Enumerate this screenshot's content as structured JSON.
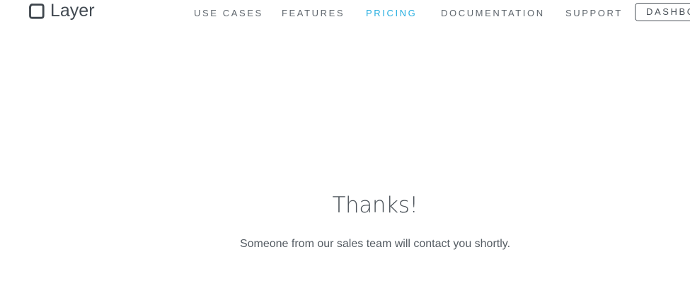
{
  "header": {
    "brand": {
      "name": "Layer",
      "icon": "layer-logo-icon"
    },
    "nav": {
      "items": [
        {
          "label": "USE CASES",
          "active": false
        },
        {
          "label": "FEATURES",
          "active": false
        },
        {
          "label": "PRICING",
          "active": true
        },
        {
          "label": "DOCUMENTATION",
          "active": false
        },
        {
          "label": "SUPPORT",
          "active": false
        }
      ],
      "dashboard_label": "DASHBOARD"
    }
  },
  "main": {
    "title": "Thanks!",
    "message": "Someone from our sales team will contact you shortly."
  },
  "colors": {
    "background": "#ffffff",
    "text": "#4a5158",
    "nav_text": "#5f666d",
    "active_nav": "#26aee0",
    "button_border": "#4a5158"
  }
}
